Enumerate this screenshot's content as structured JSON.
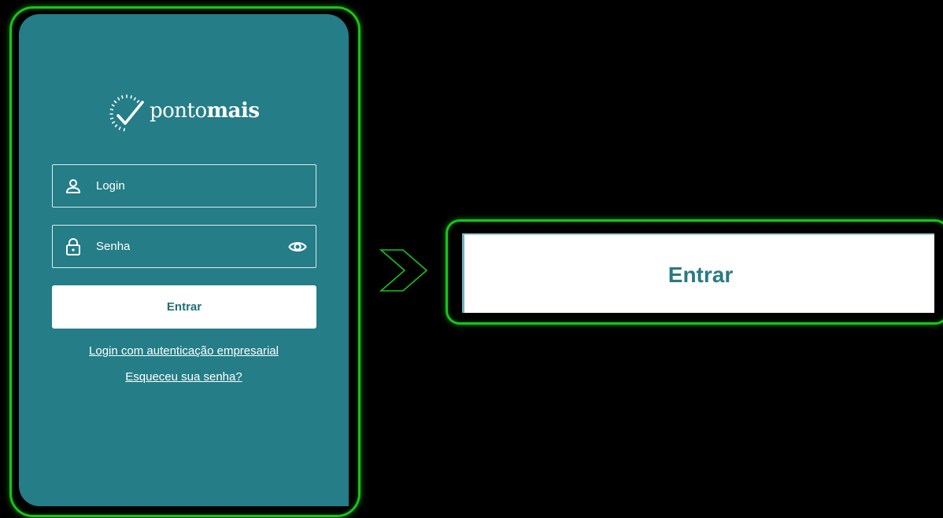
{
  "brand": {
    "name_regular": "ponto",
    "name_bold": "mais",
    "logo_icon": "clock-check-icon"
  },
  "form": {
    "login": {
      "placeholder": "Login",
      "icon": "user-icon"
    },
    "senha": {
      "placeholder": "Senha",
      "icon": "lock-icon",
      "toggle_icon": "eye-icon"
    },
    "submit_label": "Entrar"
  },
  "links": {
    "empresarial": "Login com autenticação empresarial",
    "esqueceu": "Esqueceu sua senha?"
  },
  "callout": {
    "label": "Entrar",
    "arrow_icon": "chevron-right-icon"
  },
  "colors": {
    "background": "#247d87",
    "highlight": "#19c419",
    "button_text": "#1f6f78"
  }
}
